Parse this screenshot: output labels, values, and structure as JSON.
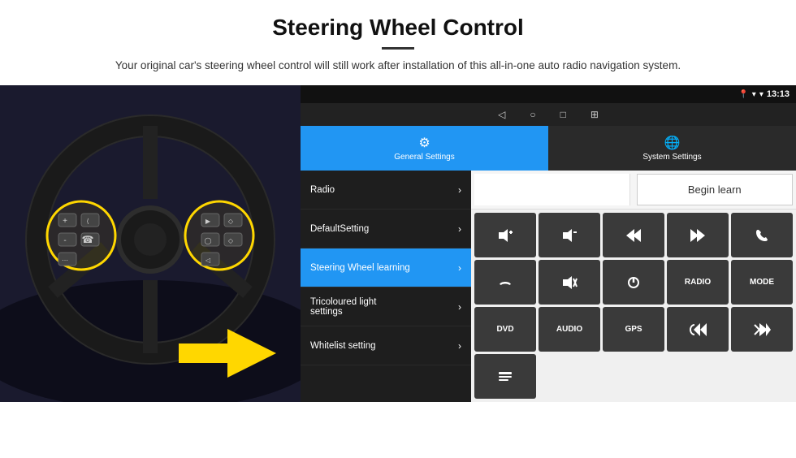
{
  "header": {
    "title": "Steering Wheel Control",
    "subtitle": "Your original car's steering wheel control will still work after installation of this all-in-one auto radio navigation system."
  },
  "status_bar": {
    "time": "13:13"
  },
  "tabs": [
    {
      "label": "General Settings",
      "icon": "⚙",
      "active": true
    },
    {
      "label": "System Settings",
      "icon": "🌐",
      "active": false
    }
  ],
  "menu": [
    {
      "label": "Radio",
      "active": false
    },
    {
      "label": "DefaultSetting",
      "active": false
    },
    {
      "label": "Steering Wheel learning",
      "active": true
    },
    {
      "label": "Tricoloured light settings",
      "active": false
    },
    {
      "label": "Whitelist setting",
      "active": false
    }
  ],
  "controls": {
    "begin_learn": "Begin learn",
    "buttons_row1": [
      "🔊+",
      "🔊-",
      "⏮",
      "⏭",
      "📞"
    ],
    "buttons_row2": [
      "📞↩",
      "🔇",
      "⏻",
      "RADIO",
      "MODE"
    ],
    "buttons_row3": [
      "DVD",
      "AUDIO",
      "GPS",
      "📞⏮",
      "↙⏭"
    ],
    "buttons_row4": [
      "📋"
    ]
  },
  "nav": {
    "icons": [
      "◁",
      "○",
      "□",
      "⊞"
    ]
  }
}
